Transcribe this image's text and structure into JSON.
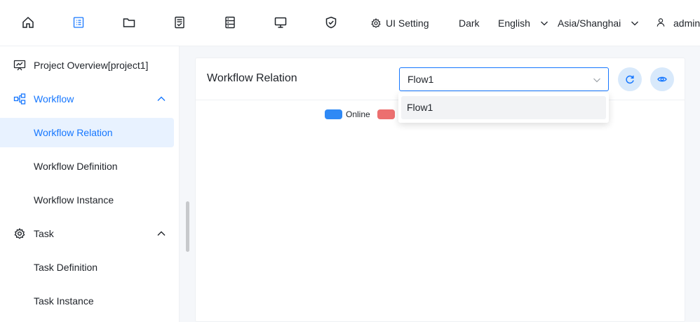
{
  "header": {
    "nav_icons": [
      "home-icon",
      "project-icon",
      "folder-icon",
      "datasource-icon",
      "monitor-list-icon",
      "desktop-icon",
      "security-icon"
    ],
    "ui_setting_label": "UI Setting",
    "theme_label": "Dark",
    "language_label": "English",
    "timezone_label": "Asia/Shanghai",
    "user_label": "admin",
    "accent_color": "#1677ff"
  },
  "sidebar": {
    "items": [
      {
        "label": "Project Overview[project1]",
        "icon": "presentation-chart-icon"
      },
      {
        "label": "Workflow",
        "icon": "workflow-icon",
        "expanded": true
      },
      {
        "label": "Workflow Relation",
        "selected": true
      },
      {
        "label": "Workflow Definition"
      },
      {
        "label": "Workflow Instance"
      },
      {
        "label": "Task",
        "icon": "gear-icon",
        "expanded": true
      },
      {
        "label": "Task Definition"
      },
      {
        "label": "Task Instance"
      }
    ]
  },
  "main": {
    "title": "Workflow Relation",
    "select": {
      "value": "Flow1",
      "options": [
        "Flow1"
      ]
    },
    "buttons": {
      "refresh": "refresh-icon",
      "view": "eye-icon"
    },
    "legend": [
      {
        "label": "Online",
        "color": "#2f89f5"
      },
      {
        "label": "",
        "color": "#ec6f6f"
      }
    ]
  }
}
